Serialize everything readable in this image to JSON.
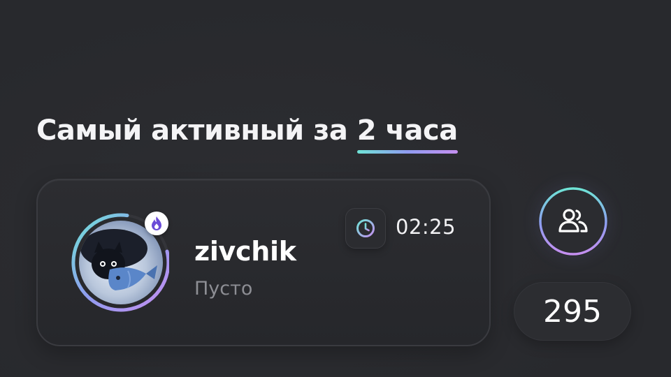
{
  "header": {
    "title_prefix": "Самый активный за ",
    "title_highlight": "2 часа"
  },
  "user_card": {
    "username": "zivchik",
    "status": "Пусто",
    "timer": "02:25",
    "avatar_icon": "cat-with-fish-avatar",
    "badge_icon": "fire-icon",
    "timer_icon": "clock-icon"
  },
  "followers": {
    "icon": "users-icon",
    "count": "295"
  },
  "colors": {
    "background": "#2a2b2f",
    "gradient_start": "#6fe3d6",
    "gradient_mid": "#8f9cf0",
    "gradient_end": "#c58ff0",
    "fire": "#6a4bd8"
  }
}
